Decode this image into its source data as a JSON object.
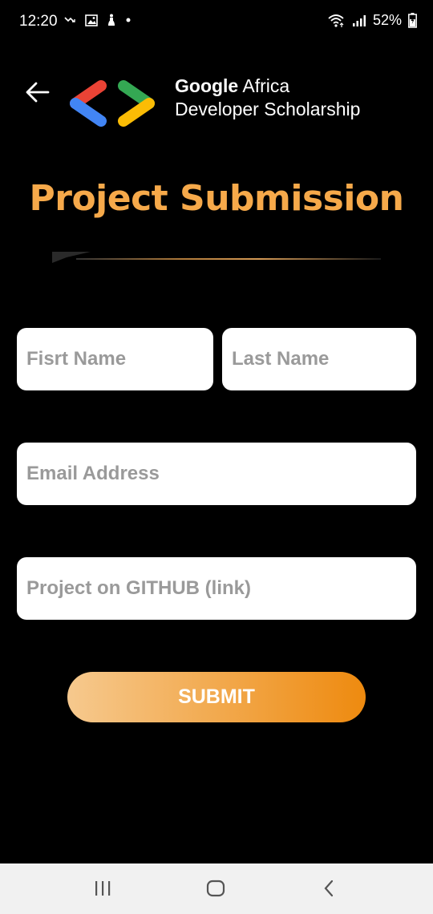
{
  "status_bar": {
    "time": "12:20",
    "battery": "52%",
    "left_icons": [
      "missed-call-icon",
      "image-icon",
      "accessibility-icon",
      "dot-icon"
    ],
    "right_icons": [
      "wifi-icon",
      "signal-icon",
      "battery-icon"
    ]
  },
  "header": {
    "brand_line1_bold": "Google",
    "brand_line1_rest": " Africa",
    "brand_line2": "Developer Scholarship"
  },
  "page": {
    "title": "Project Submission"
  },
  "form": {
    "first_name_placeholder": "Fisrt Name",
    "last_name_placeholder": "Last Name",
    "email_placeholder": "Email Address",
    "github_placeholder": "Project on GITHUB (link)",
    "submit_label": "SUBMIT"
  },
  "colors": {
    "title": "#F6A94A",
    "submit_start": "#F6C98E",
    "submit_end": "#EE8A0F",
    "logo_red": "#EA4335",
    "logo_blue": "#4285F4",
    "logo_green": "#34A853",
    "logo_yellow": "#FBBC05"
  },
  "navbar": {
    "icons": [
      "recent-apps-icon",
      "home-icon",
      "back-icon"
    ]
  }
}
